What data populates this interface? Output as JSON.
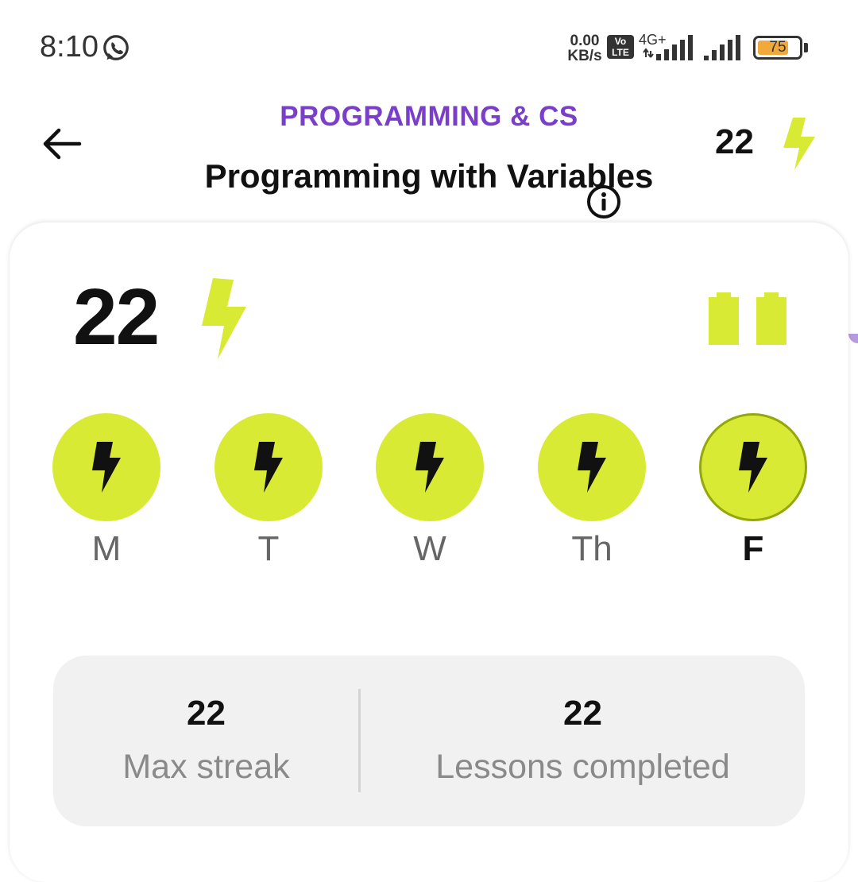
{
  "status_bar": {
    "time": "8:10",
    "speed_value": "0.00",
    "speed_unit": "KB/s",
    "volte_top": "Vo",
    "volte_bottom": "LTE",
    "network_type": "4G+",
    "battery": "75",
    "battery_level": 0.75,
    "battery_color": "#f2a93b"
  },
  "header": {
    "category": "PROGRAMMING & CS",
    "title": "Programming with Variables",
    "streak_count": "22",
    "accent_color": "#7a3fc9"
  },
  "streak_card": {
    "streak_count": "22",
    "bolt_color": "#d8ea33",
    "days": [
      {
        "label": "M",
        "completed": true,
        "today": false
      },
      {
        "label": "T",
        "completed": true,
        "today": false
      },
      {
        "label": "W",
        "completed": true,
        "today": false
      },
      {
        "label": "Th",
        "completed": true,
        "today": false
      },
      {
        "label": "F",
        "completed": true,
        "today": true
      }
    ],
    "stats": [
      {
        "value": "22",
        "label": "Max streak"
      },
      {
        "value": "22",
        "label": "Lessons completed"
      }
    ]
  }
}
